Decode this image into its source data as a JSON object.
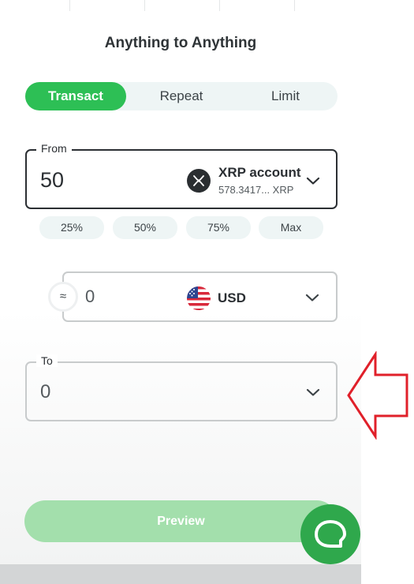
{
  "title": "Anything to Anything",
  "tabs": [
    {
      "label": "Transact",
      "active": true
    },
    {
      "label": "Repeat",
      "active": false
    },
    {
      "label": "Limit",
      "active": false
    }
  ],
  "from": {
    "legend": "From",
    "amount": "50",
    "account_name": "XRP account",
    "account_balance": "578.3417...  XRP",
    "icon": "xrp-icon"
  },
  "percent_buttons": [
    "25%",
    "50%",
    "75%",
    "Max"
  ],
  "conversion": {
    "swap_glyph": "≈",
    "amount": "0",
    "currency": "USD",
    "icon": "us-flag-icon"
  },
  "to": {
    "legend": "To",
    "amount": "0"
  },
  "preview_label": "Preview",
  "colors": {
    "accent": "#2dbf55",
    "preview_disabled": "#a3dfac",
    "chat_button": "#2fa84c",
    "annotation_arrow": "#e0202a"
  }
}
